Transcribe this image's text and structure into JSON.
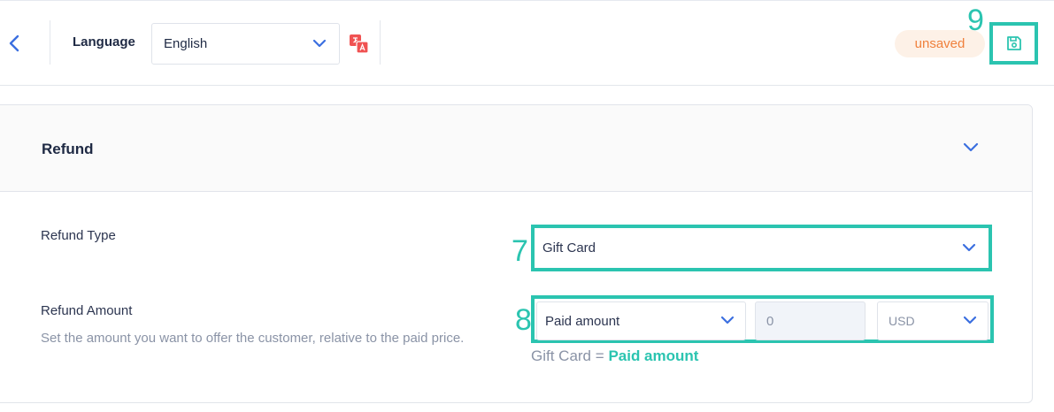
{
  "header": {
    "language_label": "Language",
    "language_value": "English",
    "status_badge": "unsaved"
  },
  "annotations": [
    "9",
    "7",
    "8"
  ],
  "section": {
    "title": "Refund"
  },
  "refund_type": {
    "label": "Refund Type",
    "value": "Gift Card"
  },
  "refund_amount": {
    "label": "Refund Amount",
    "help": "Set the amount you want to offer the customer, relative to the paid price.",
    "basis": "Paid amount",
    "amount": "0",
    "currency": "USD"
  },
  "formula": {
    "left": "Gift Card",
    "op": "=",
    "right": "Paid amount"
  },
  "colors": {
    "accent": "#2bc4b0",
    "chevron": "#3b6fe0",
    "badge_text": "#f0803c",
    "badge_bg": "#fdf1e7",
    "translate_icon": "#f05252"
  }
}
